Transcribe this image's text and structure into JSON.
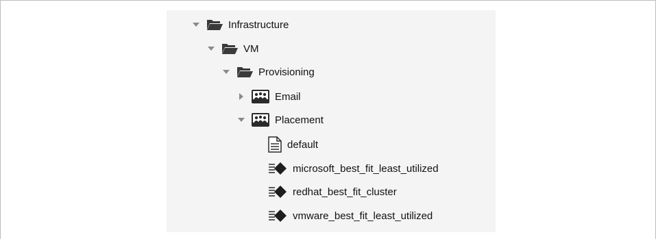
{
  "tree": {
    "items": [
      {
        "label": "Infrastructure",
        "icon": "folder-open-icon",
        "toggle": "expanded"
      },
      {
        "label": "VM",
        "icon": "folder-open-icon",
        "toggle": "expanded"
      },
      {
        "label": "Provisioning",
        "icon": "folder-open-icon",
        "toggle": "expanded"
      },
      {
        "label": "Email",
        "icon": "class-icon",
        "toggle": "collapsed"
      },
      {
        "label": "Placement",
        "icon": "class-icon",
        "toggle": "expanded"
      },
      {
        "label": "default",
        "icon": "instance-document-icon",
        "toggle": "none"
      },
      {
        "label": "microsoft_best_fit_least_utilized",
        "icon": "method-icon",
        "toggle": "none"
      },
      {
        "label": "redhat_best_fit_cluster",
        "icon": "method-icon",
        "toggle": "none"
      },
      {
        "label": "vmware_best_fit_least_utilized",
        "icon": "method-icon",
        "toggle": "none"
      }
    ]
  }
}
